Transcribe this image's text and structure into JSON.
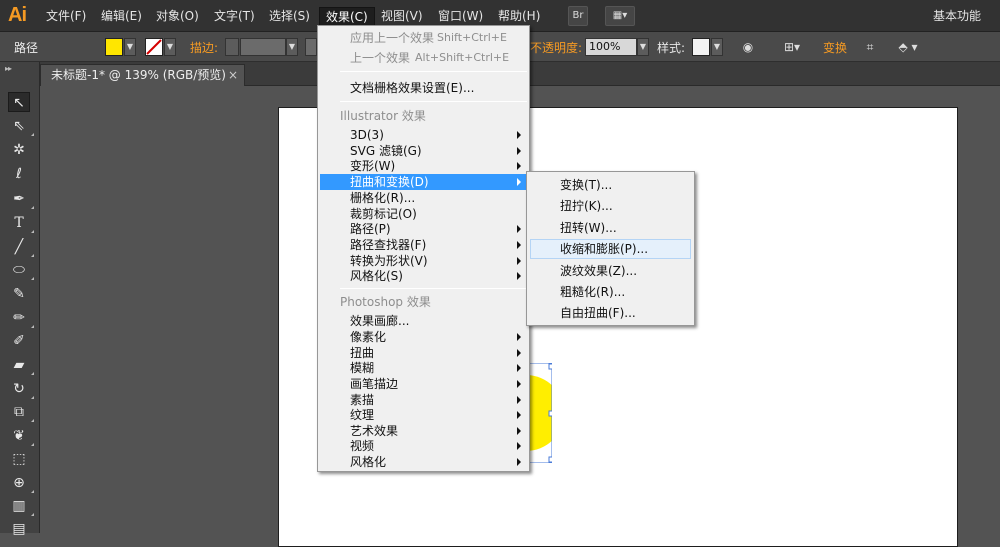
{
  "app": {
    "logo": "Ai"
  },
  "menubar": {
    "items": [
      "文件(F)",
      "编辑(E)",
      "对象(O)",
      "文字(T)",
      "选择(S)",
      "效果(C)",
      "视图(V)",
      "窗口(W)",
      "帮助(H)"
    ],
    "bridge_label": "Br",
    "workspace": "基本功能"
  },
  "controlbar": {
    "path_label": "路径",
    "fill_color": "#ffe600",
    "stroke_label": "描边:",
    "opacity_label": "不透明度:",
    "opacity_value": "100%",
    "style_label": "样式:",
    "transform_label": "变换"
  },
  "document_tab": {
    "title": "未标题-1* @ 139% (RGB/预览)",
    "close": "×"
  },
  "effect_menu": {
    "apply_last": {
      "label": "应用上一个效果",
      "shortcut": "Shift+Ctrl+E"
    },
    "last_effect": {
      "label": "上一个效果",
      "shortcut": "Alt+Shift+Ctrl+E"
    },
    "raster_settings": "文档栅格效果设置(E)...",
    "illustrator_group": "Illustrator 效果",
    "illustrator_items": [
      "3D(3)",
      "SVG 滤镜(G)",
      "变形(W)",
      "扭曲和变换(D)",
      "栅格化(R)...",
      "裁剪标记(O)",
      "路径(P)",
      "路径查找器(F)",
      "转换为形状(V)",
      "风格化(S)"
    ],
    "photoshop_group": "Photoshop 效果",
    "photoshop_items": [
      "效果画廊...",
      "像素化",
      "扭曲",
      "模糊",
      "画笔描边",
      "素描",
      "纹理",
      "艺术效果",
      "视频",
      "风格化"
    ]
  },
  "distort_submenu": {
    "items": [
      "变换(T)...",
      "扭拧(K)...",
      "扭转(W)...",
      "收缩和膨胀(P)...",
      "波纹效果(Z)...",
      "粗糙化(R)...",
      "自由扭曲(F)..."
    ]
  },
  "colors": {
    "accent": "#f59a23",
    "highlight": "#3399ff",
    "shape_fill": "#ffee00"
  }
}
